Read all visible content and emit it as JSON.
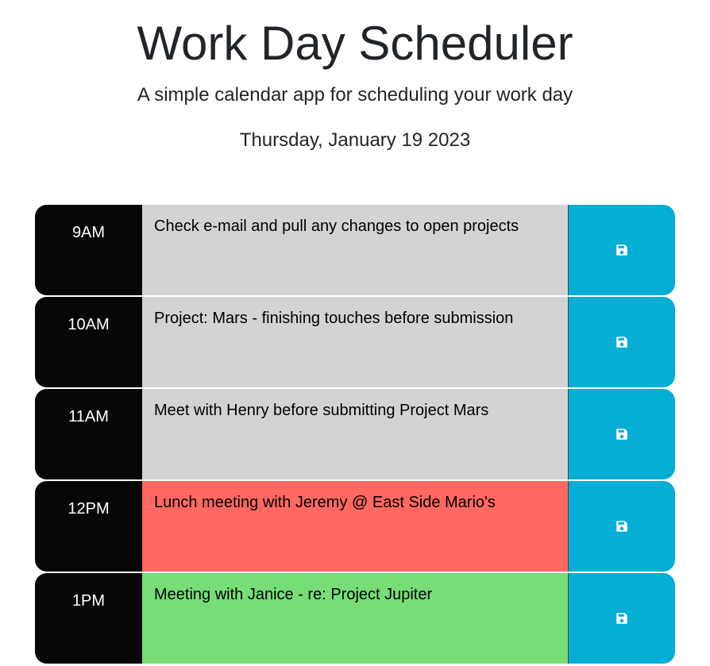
{
  "header": {
    "title": "Work Day Scheduler",
    "subtitle": "A simple calendar app for scheduling your work day",
    "date": "Thursday, January 19 2023"
  },
  "rows": [
    {
      "hour": "9AM",
      "task": "Check e-mail and pull any changes to open projects",
      "status": "past"
    },
    {
      "hour": "10AM",
      "task": "Project: Mars - finishing touches before submission",
      "status": "past"
    },
    {
      "hour": "11AM",
      "task": "Meet with Henry before submitting Project Mars",
      "status": "past"
    },
    {
      "hour": "12PM",
      "task": "Lunch meeting with Jeremy @ East Side Mario's",
      "status": "present"
    },
    {
      "hour": "1PM",
      "task": "Meeting with Janice - re: Project Jupiter",
      "status": "future"
    }
  ],
  "save_icon": "save-icon",
  "colors": {
    "hour_bg": "#070707",
    "past": "#d3d3d3",
    "present": "#ff6961",
    "future": "#77dd77",
    "save_bg": "#06aed5"
  }
}
